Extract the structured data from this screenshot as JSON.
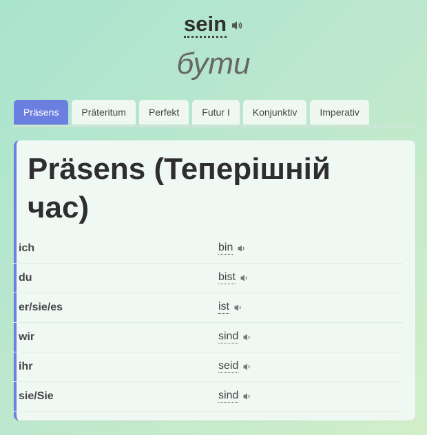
{
  "header": {
    "word": "sein",
    "translation": "бути"
  },
  "tabs": [
    {
      "label": "Präsens",
      "active": true
    },
    {
      "label": "Präteritum",
      "active": false
    },
    {
      "label": "Perfekt",
      "active": false
    },
    {
      "label": "Futur I",
      "active": false
    },
    {
      "label": "Konjunktiv",
      "active": false
    },
    {
      "label": "Imperativ",
      "active": false
    }
  ],
  "card": {
    "title": "Präsens (Теперішній час)",
    "rows": [
      {
        "pronoun": "ich",
        "verb": "bin"
      },
      {
        "pronoun": "du",
        "verb": "bist"
      },
      {
        "pronoun": "er/sie/es",
        "verb": "ist"
      },
      {
        "pronoun": "wir",
        "verb": "sind"
      },
      {
        "pronoun": "ihr",
        "verb": "seid"
      },
      {
        "pronoun": "sie/Sie",
        "verb": "sind"
      }
    ]
  },
  "colors": {
    "accent": "#6a7fe0",
    "background": "#bfe8cd",
    "card": "#eff8f2"
  },
  "icons": {
    "pronounce": "speaker-icon"
  }
}
